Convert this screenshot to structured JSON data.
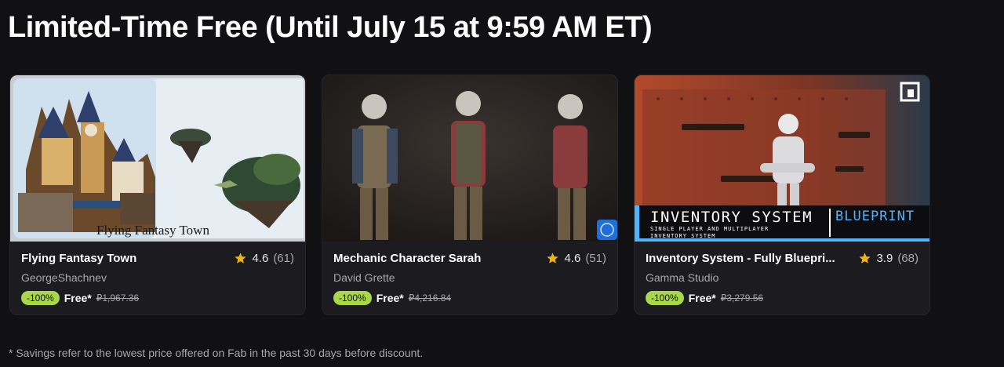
{
  "page": {
    "title": "Limited-Time Free (Until July 15 at 9:59 AM ET)",
    "footnote": "* Savings refer to the lowest price offered on Fab in the past 30 days before discount."
  },
  "colors": {
    "background": "#111113",
    "card": "#1c1c20",
    "discount_badge": "#a8d84a",
    "star": "#f5b400",
    "muted_text": "#a7a7ad"
  },
  "cards": [
    {
      "title": "Flying Fantasy Town",
      "rating": "4.6",
      "rating_count": "(61)",
      "seller": "GeorgeShachnev",
      "discount": "-100%",
      "price": "Free*",
      "original_price": "₽1,967.36",
      "thumbnail_caption": "Flying Fantasy Town"
    },
    {
      "title": "Mechanic Character Sarah",
      "rating": "4.6",
      "rating_count": "(51)",
      "seller": "David Grette",
      "discount": "-100%",
      "price": "Free*",
      "original_price": "₽4,216.84"
    },
    {
      "title": "Inventory System - Fully Bluepri...",
      "rating": "3.9",
      "rating_count": "(68)",
      "seller": "Gamma Studio",
      "discount": "-100%",
      "price": "Free*",
      "original_price": "₽3,279.56",
      "thumbnail_title": "INVENTORY SYSTEM",
      "thumbnail_tag": "BLUEPRINT",
      "thumbnail_sub1": "SINGLE PLAYER AND MULTIPLAYER",
      "thumbnail_sub2": "INVENTORY SYSTEM"
    }
  ],
  "icons": {
    "rating": "star-icon",
    "marketplace": "gamma-logo-icon",
    "certified": "face-scan-icon"
  }
}
